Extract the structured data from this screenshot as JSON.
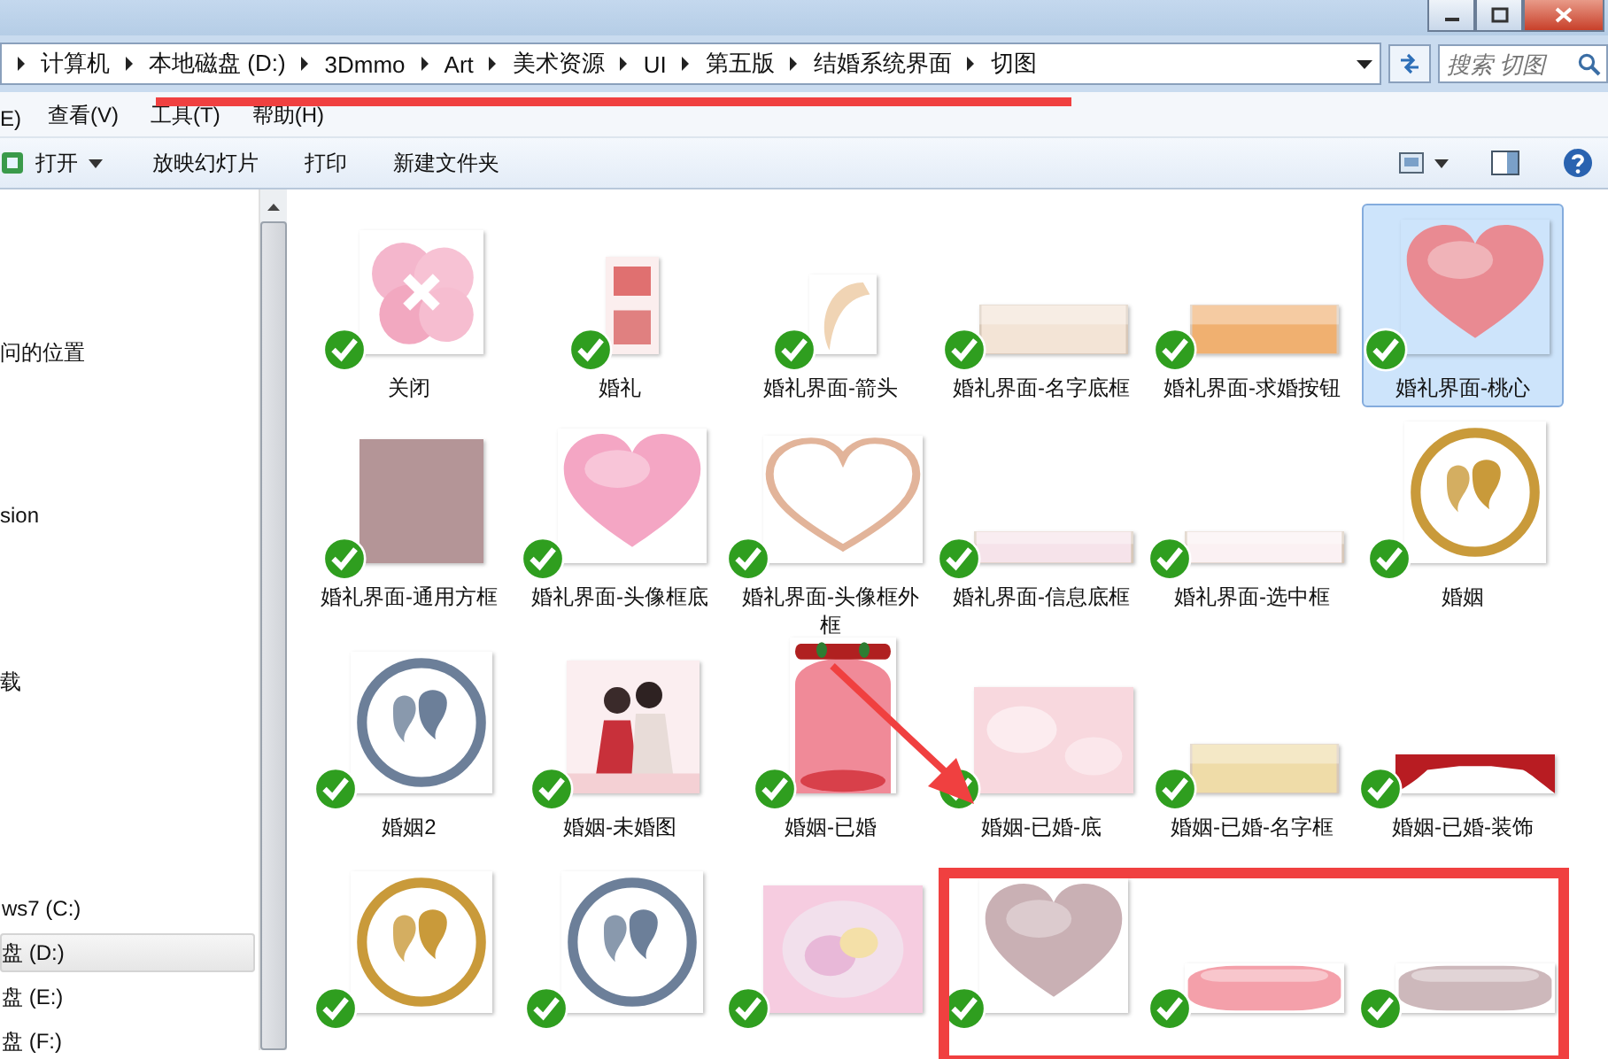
{
  "address_bar": {
    "breadcrumbs": [
      "计算机",
      "本地磁盘 (D:)",
      "3Dmmo",
      "Art",
      "美术资源",
      "UI",
      "第五版",
      "结婚系统界面",
      "切图"
    ],
    "search": {
      "placeholder": "搜索 切图"
    }
  },
  "menu_bar": [
    "E)",
    "查看(V)",
    "工具(T)",
    "帮助(H)"
  ],
  "toolbar": [
    {
      "label": "打开",
      "kind": "open"
    },
    {
      "label": "放映幻灯片",
      "kind": "plain"
    },
    {
      "label": "打印",
      "kind": "plain"
    },
    {
      "label": "新建文件夹",
      "kind": "plain"
    }
  ],
  "sidebar": {
    "places": [
      {
        "label": "问的位置"
      },
      {
        "label": "sion"
      },
      {
        "label": "载"
      }
    ],
    "drives": [
      {
        "label": "ws7 (C:)",
        "selected": false
      },
      {
        "label": "盘 (D:)",
        "selected": true
      },
      {
        "label": "盘 (E:)",
        "selected": false
      },
      {
        "label": "盘 (F:)",
        "selected": false
      }
    ]
  },
  "files": [
    {
      "label": "关闭",
      "kind": "flower",
      "checked": true,
      "selected": false
    },
    {
      "label": "婚礼",
      "kind": "glyph-tile",
      "checked": true,
      "selected": false
    },
    {
      "label": "婚礼界面-箭头",
      "kind": "crescent",
      "checked": true,
      "selected": false
    },
    {
      "label": "婚礼界面-名字底框",
      "kind": "bar",
      "color": "#f3e4d6",
      "checked": true,
      "selected": false
    },
    {
      "label": "婚礼界面-求婚按钮",
      "kind": "bar",
      "color": "#f0b070",
      "checked": true,
      "selected": false
    },
    {
      "label": "婚礼界面-桃心",
      "kind": "heart",
      "color": "#e98a92",
      "checked": true,
      "selected": true
    },
    {
      "label": "婚礼界面-通用方框",
      "kind": "square",
      "color": "#b49597",
      "checked": true,
      "selected": false
    },
    {
      "label": "婚礼界面-头像框底",
      "kind": "heart",
      "color": "#f4a6c4",
      "checked": true,
      "selected": false
    },
    {
      "label": "婚礼界面-头像框外框",
      "kind": "heart-outline",
      "color": "#e2b49a",
      "checked": true,
      "selected": false
    },
    {
      "label": "婚礼界面-信息底框",
      "kind": "thin-bar",
      "color": "#f6e3ea",
      "checked": true,
      "selected": false
    },
    {
      "label": "婚礼界面-选中框",
      "kind": "thin-bar",
      "color": "#fbf1f3",
      "checked": true,
      "selected": false
    },
    {
      "label": "婚姻",
      "kind": "ring",
      "color": "#c99a3a",
      "checked": true,
      "selected": false
    },
    {
      "label": "婚姻2",
      "kind": "ring",
      "color": "#6c7f99",
      "checked": true,
      "selected": false
    },
    {
      "label": "婚姻-未婚图",
      "kind": "picture",
      "checked": true,
      "selected": false
    },
    {
      "label": "婚姻-已婚",
      "kind": "arch",
      "color": "#f08a98",
      "checked": true,
      "selected": false
    },
    {
      "label": "婚姻-已婚-底",
      "kind": "panel",
      "color": "#f8d8de",
      "checked": true,
      "selected": false
    },
    {
      "label": "婚姻-已婚-名字框",
      "kind": "bar",
      "color": "#efdca8",
      "checked": true,
      "selected": false
    },
    {
      "label": "婚姻-已婚-装饰",
      "kind": "curtain",
      "color": "#b81c22",
      "checked": true,
      "selected": false
    },
    {
      "kind": "ring",
      "color": "#c99a3a",
      "checked": true,
      "selected": false
    },
    {
      "kind": "ring",
      "color": "#6c7f99",
      "checked": true,
      "selected": false
    },
    {
      "kind": "orb",
      "color": "#f6cce0",
      "checked": true,
      "selected": false
    },
    {
      "kind": "heart",
      "color": "#c9b0b4",
      "checked": true,
      "selected": false
    },
    {
      "kind": "pill",
      "color": "#f4a0aa",
      "checked": true,
      "selected": false
    },
    {
      "kind": "pill",
      "color": "#cdb8bb",
      "checked": true,
      "selected": false
    }
  ],
  "annotations": [
    {
      "kind": "underline"
    },
    {
      "kind": "arrow"
    },
    {
      "kind": "box"
    }
  ]
}
